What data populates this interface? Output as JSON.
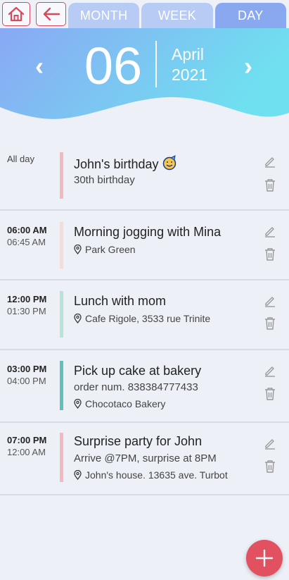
{
  "nav": {
    "tabs": [
      {
        "label": "MONTH",
        "active": false
      },
      {
        "label": "WEEK",
        "active": false
      },
      {
        "label": "DAY",
        "active": true
      }
    ]
  },
  "header": {
    "prev_arrow": "‹",
    "next_arrow": "›",
    "day": "06",
    "month": "April",
    "year": "2021"
  },
  "events": [
    {
      "all_day_label": "All day",
      "title": "John's birthday",
      "subtitle": "30th birthday",
      "color": "#f5b8bd"
    },
    {
      "start": "06:00 AM",
      "end": "06:45 AM",
      "title": "Morning jogging with Mina",
      "location": "Park Green",
      "color": "#f7dcd5"
    },
    {
      "start": "12:00 PM",
      "end": "01:30 PM",
      "title": "Lunch with mom",
      "location": "Cafe Rigole, 3533 rue Trinite",
      "color": "#b9e2d8"
    },
    {
      "start": "03:00 PM",
      "end": "04:00 PM",
      "title": "Pick up cake at bakery",
      "subtitle": "order num. 838384777433",
      "location": "Chocotaco Bakery",
      "color": "#5fc1b8"
    },
    {
      "start": "07:00 PM",
      "end": "12:00 AM",
      "title": "Surprise party for John",
      "subtitle": "Arrive @7PM, surprise at 8PM",
      "location": "John's house. 13635 ave. Turbot",
      "color": "#f5b8bd"
    }
  ],
  "colors": {
    "accent_red": "#e2515f",
    "tab_inactive": "#b8cbf4",
    "tab_active": "#8aa8ef",
    "gradient_start": "#8aa8f4",
    "gradient_end": "#6fe0f0"
  }
}
